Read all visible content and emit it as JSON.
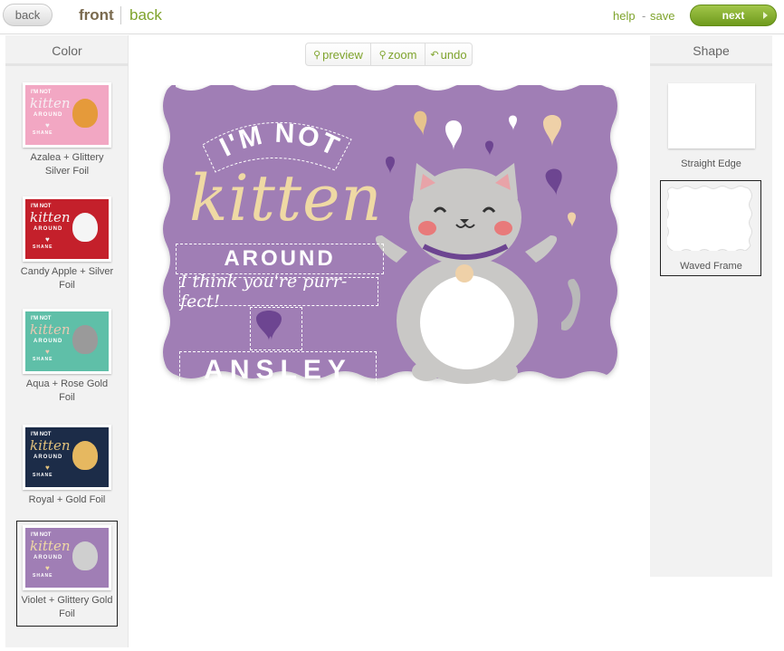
{
  "topbar": {
    "back_button": "back",
    "tab_front": "front",
    "tab_back": "back",
    "help": "help",
    "separator": "-",
    "save": "save",
    "next": "next"
  },
  "color_panel": {
    "title": "Color",
    "swatches": [
      {
        "label": "Azalea + Glittery Silver Foil",
        "bg": "#f2a7c3",
        "script": "#f6eef3",
        "cat": "#e59a3a",
        "selected": false
      },
      {
        "label": "Candy Apple + Silver Foil",
        "bg": "#c4202b",
        "script": "#f4f4f4",
        "cat": "#f5f5f5",
        "selected": false
      },
      {
        "label": "Aqua + Rose Gold Foil",
        "bg": "#5fbfa8",
        "script": "#e9c9b3",
        "cat": "#9a9a9a",
        "selected": false
      },
      {
        "label": "Royal + Gold Foil",
        "bg": "#1c2c48",
        "script": "#e2c27c",
        "cat": "#e6b860",
        "selected": false
      },
      {
        "label": "Violet + Glittery Gold Foil",
        "bg": "#a07eb5",
        "script": "#efd9a4",
        "cat": "#cfcfcf",
        "selected": true
      }
    ],
    "thumb_text": {
      "line1": "I'M NOT",
      "line2": "kitten",
      "line3": "AROUND",
      "name": "SHANE"
    }
  },
  "toolbar": {
    "preview": "preview",
    "zoom": "zoom",
    "undo": "undo"
  },
  "card": {
    "bg": "#a07eb5",
    "line1": "I'M NOT",
    "line2": "kitten",
    "line3": "AROUND",
    "message": "I think you're purr-fect!",
    "name": "ANSLEY"
  },
  "shape_panel": {
    "title": "Shape",
    "options": [
      {
        "label": "Straight Edge",
        "selected": false
      },
      {
        "label": "Waved Frame",
        "selected": true
      }
    ]
  }
}
